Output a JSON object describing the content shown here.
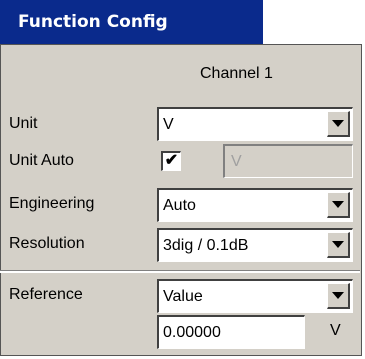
{
  "window": {
    "title": "Function Config"
  },
  "column_header": "Channel 1",
  "fields": {
    "unit": {
      "label": "Unit",
      "value": "V"
    },
    "unit_auto": {
      "label": "Unit Auto",
      "checked": true,
      "check_glyph": "✔",
      "disabled_value": "V"
    },
    "engineering": {
      "label": "Engineering",
      "value": "Auto"
    },
    "resolution": {
      "label": "Resolution",
      "value": "3dig / 0.1dB"
    },
    "reference": {
      "label": "Reference",
      "value": "Value"
    },
    "reference_value": {
      "value": "0.00000",
      "unit": "V"
    }
  },
  "colors": {
    "title_bar": "#0a2a8c",
    "panel_bg": "#d4d0c8"
  }
}
